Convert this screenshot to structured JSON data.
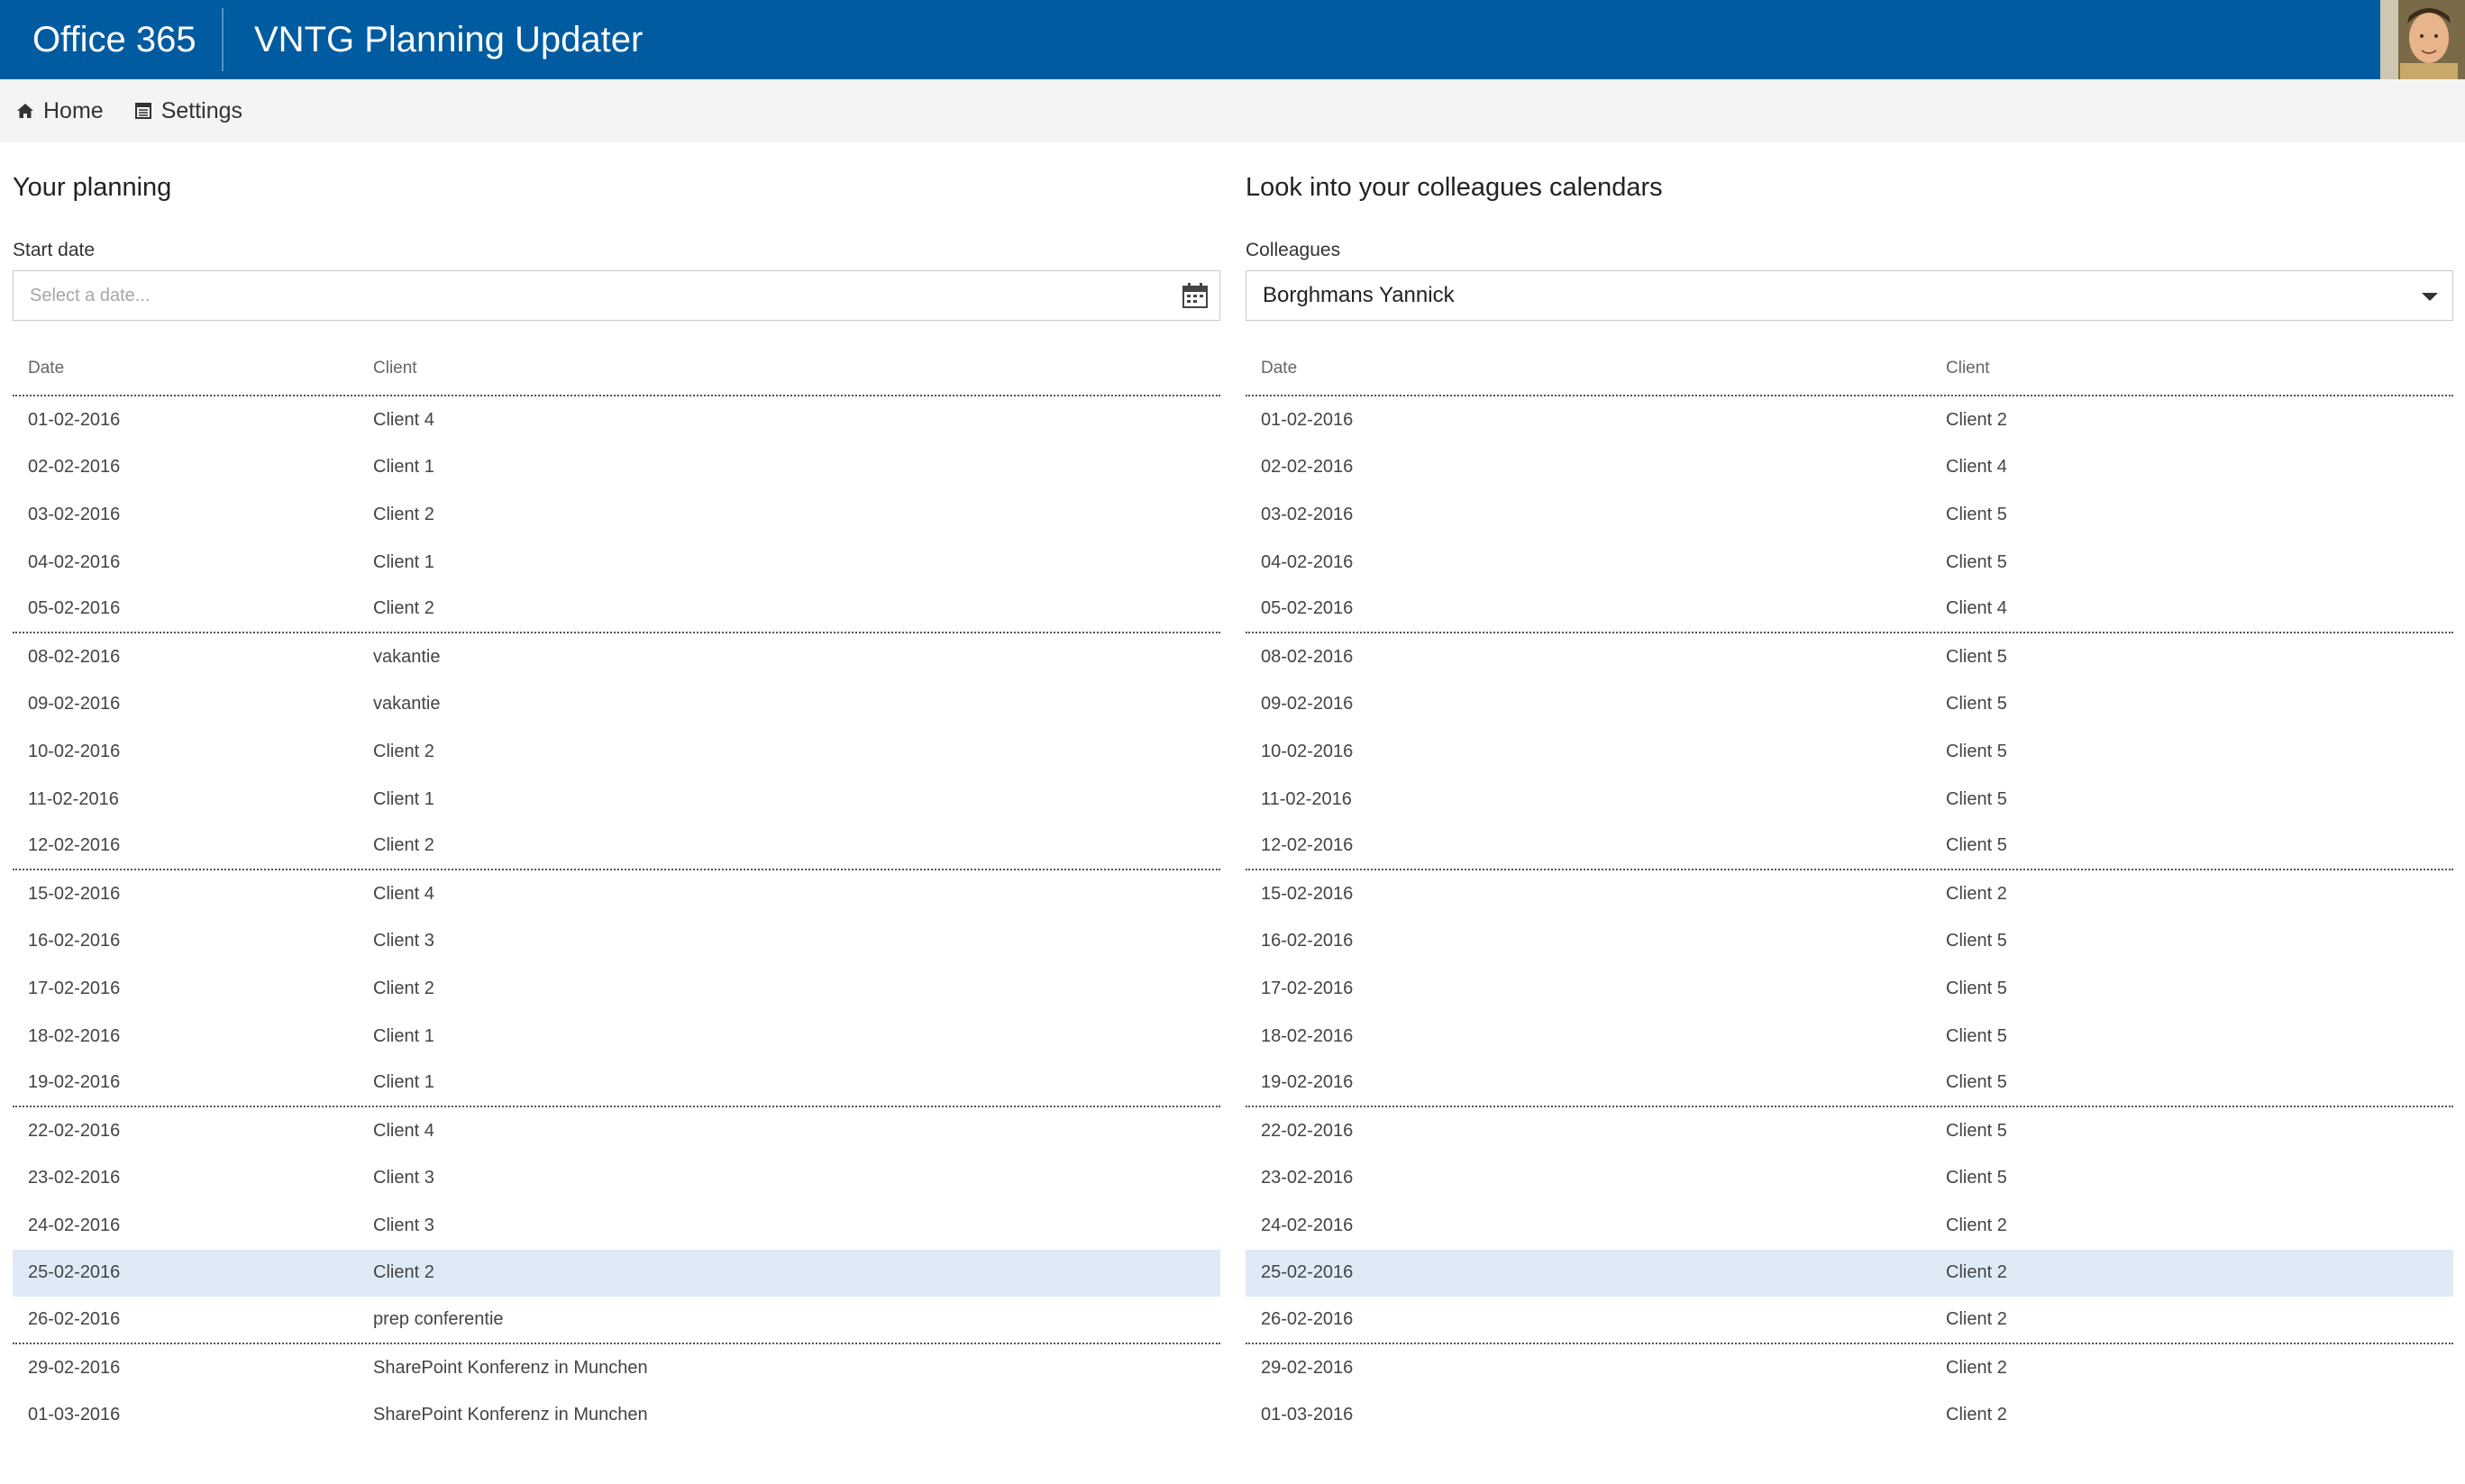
{
  "header": {
    "brand": "Office 365",
    "app_title": "VNTG Planning Updater",
    "accent_color": "#005ba1"
  },
  "nav": {
    "items": [
      {
        "label": "Home",
        "icon": "home-icon"
      },
      {
        "label": "Settings",
        "icon": "settings-icon"
      }
    ]
  },
  "left_panel": {
    "title": "Your planning",
    "field_label": "Start date",
    "date_placeholder": "Select a date...",
    "columns": [
      "Date",
      "Client"
    ],
    "rows": [
      {
        "date": "01-02-2016",
        "client": "Client 4"
      },
      {
        "date": "02-02-2016",
        "client": "Client 1"
      },
      {
        "date": "03-02-2016",
        "client": "Client 2"
      },
      {
        "date": "04-02-2016",
        "client": "Client 1"
      },
      {
        "date": "05-02-2016",
        "client": "Client 2"
      },
      {
        "date": "08-02-2016",
        "client": "vakantie"
      },
      {
        "date": "09-02-2016",
        "client": "vakantie"
      },
      {
        "date": "10-02-2016",
        "client": "Client 2"
      },
      {
        "date": "11-02-2016",
        "client": "Client 1"
      },
      {
        "date": "12-02-2016",
        "client": "Client 2"
      },
      {
        "date": "15-02-2016",
        "client": "Client 4"
      },
      {
        "date": "16-02-2016",
        "client": "Client 3"
      },
      {
        "date": "17-02-2016",
        "client": "Client 2"
      },
      {
        "date": "18-02-2016",
        "client": "Client 1"
      },
      {
        "date": "19-02-2016",
        "client": "Client 1"
      },
      {
        "date": "22-02-2016",
        "client": "Client 4"
      },
      {
        "date": "23-02-2016",
        "client": "Client 3"
      },
      {
        "date": "24-02-2016",
        "client": "Client 3"
      },
      {
        "date": "25-02-2016",
        "client": "Client 2"
      },
      {
        "date": "26-02-2016",
        "client": "prep conferentie"
      },
      {
        "date": "29-02-2016",
        "client": "SharePoint Konferenz in Munchen"
      },
      {
        "date": "01-03-2016",
        "client": "SharePoint Konferenz in Munchen"
      }
    ]
  },
  "right_panel": {
    "title": "Look into your colleagues calendars",
    "field_label": "Colleagues",
    "selected_colleague": "Borghmans Yannick",
    "columns": [
      "Date",
      "Client"
    ],
    "rows": [
      {
        "date": "01-02-2016",
        "client": "Client 2"
      },
      {
        "date": "02-02-2016",
        "client": "Client 4"
      },
      {
        "date": "03-02-2016",
        "client": "Client 5"
      },
      {
        "date": "04-02-2016",
        "client": "Client 5"
      },
      {
        "date": "05-02-2016",
        "client": "Client 4"
      },
      {
        "date": "08-02-2016",
        "client": "Client 5"
      },
      {
        "date": "09-02-2016",
        "client": "Client 5"
      },
      {
        "date": "10-02-2016",
        "client": "Client 5"
      },
      {
        "date": "11-02-2016",
        "client": "Client 5"
      },
      {
        "date": "12-02-2016",
        "client": "Client 5"
      },
      {
        "date": "15-02-2016",
        "client": "Client 2"
      },
      {
        "date": "16-02-2016",
        "client": "Client 5"
      },
      {
        "date": "17-02-2016",
        "client": "Client 5"
      },
      {
        "date": "18-02-2016",
        "client": "Client 5"
      },
      {
        "date": "19-02-2016",
        "client": "Client 5"
      },
      {
        "date": "22-02-2016",
        "client": "Client 5"
      },
      {
        "date": "23-02-2016",
        "client": "Client 5"
      },
      {
        "date": "24-02-2016",
        "client": "Client 2"
      },
      {
        "date": "25-02-2016",
        "client": "Client 2"
      },
      {
        "date": "26-02-2016",
        "client": "Client 2"
      },
      {
        "date": "29-02-2016",
        "client": "Client 2"
      },
      {
        "date": "01-03-2016",
        "client": "Client 2"
      }
    ]
  },
  "table_meta": {
    "selected_date": "25-02-2016",
    "selected_color": "#deebf7"
  }
}
